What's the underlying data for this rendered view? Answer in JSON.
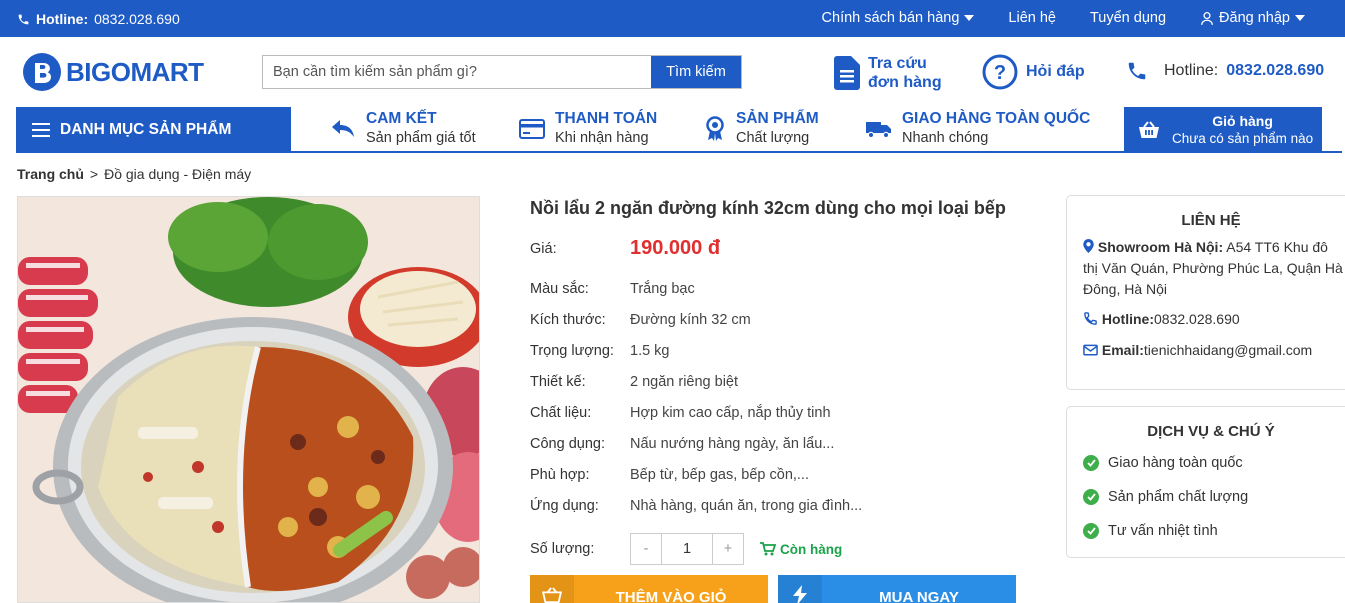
{
  "topbar": {
    "hotline_label": "Hotline:",
    "hotline_number": "0832.028.690",
    "menu": [
      "Chính sách bán hàng",
      "Liên hệ",
      "Tuyển dụng",
      "Đăng nhập"
    ]
  },
  "header": {
    "logo_text": "BIGOMART",
    "search_placeholder": "Bạn cần tìm kiếm sản phẩm gì?",
    "search_button": "Tìm kiếm",
    "lookup_line1": "Tra cứu",
    "lookup_line2": "đơn hàng",
    "faq": "Hỏi đáp",
    "hotline_label": "Hotline:",
    "hotline_number": "0832.028.690"
  },
  "nav": {
    "category_button": "DANH MỤC SẢN PHẨM",
    "features": [
      {
        "title": "CAM KẾT",
        "sub": "Sản phẩm giá tốt"
      },
      {
        "title": "THANH TOÁN",
        "sub": "Khi nhận hàng"
      },
      {
        "title": "SẢN PHẨM",
        "sub": "Chất lượng"
      },
      {
        "title": "GIAO HÀNG TOÀN QUỐC",
        "sub": "Nhanh chóng"
      }
    ],
    "cart_title": "Giỏ hàng",
    "cart_sub": "Chưa có sản phẩm nào"
  },
  "breadcrumb": {
    "home": "Trang chủ",
    "separator": ">",
    "current": "Đồ gia dụng - Điện máy"
  },
  "product": {
    "title": "Nồi lẩu 2 ngăn đường kính 32cm dùng cho mọi loại bếp",
    "price_label": "Giá:",
    "price": "190.000 đ",
    "specs": [
      {
        "k": "Màu sắc:",
        "v": "Trắng bạc"
      },
      {
        "k": "Kích thước:",
        "v": "Đường kính 32 cm"
      },
      {
        "k": "Trọng lượng:",
        "v": "1.5 kg"
      },
      {
        "k": "Thiết kế:",
        "v": "2 ngăn riêng biệt"
      },
      {
        "k": "Chất liệu:",
        "v": "Hợp kim cao cấp, nắp thủy tinh"
      },
      {
        "k": "Công dụng:",
        "v": "Nấu nướng hàng ngày, ăn lẩu..."
      },
      {
        "k": "Phù hợp:",
        "v": "Bếp từ, bếp gas, bếp cồn,..."
      },
      {
        "k": "Ứng dụng:",
        "v": "Nhà hàng, quán ăn, trong gia đình..."
      }
    ],
    "qty_label": "Số lượng:",
    "qty_minus": "-",
    "qty_value": "1",
    "qty_plus": "+",
    "stock": "Còn hàng",
    "add_to_cart": "THÊM VÀO GIỎ",
    "buy_now": "MUA NGAY"
  },
  "contact": {
    "title": "LIÊN HỆ",
    "showroom_label": "Showroom Hà Nội:",
    "showroom_addr": "A54 TT6 Khu đô thị Văn Quán, Phường Phúc La, Quận Hà Đông, Hà Nội",
    "hotline_label": "Hotline:",
    "hotline": "0832.028.690",
    "email_label": "Email:",
    "email": "tienichhaidang@gmail.com"
  },
  "service": {
    "title": "DỊCH VỤ & CHÚ Ý",
    "items": [
      "Giao hàng toàn quốc",
      "Sản phẩm chất lượng",
      "Tư vấn nhiệt tình"
    ]
  },
  "colors": {
    "brand": "#1f5bc5",
    "price": "#e02f2f",
    "add": "#f7a11a",
    "buy": "#2a8de6",
    "stock": "#1aa34a"
  }
}
